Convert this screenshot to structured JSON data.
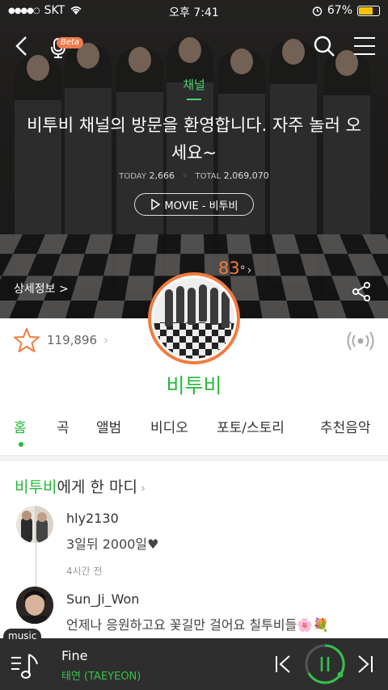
{
  "status_bar": {
    "carrier": "SKT",
    "time": "오후 7:41",
    "battery": "67%"
  },
  "header": {
    "beta_label": "Beta"
  },
  "channel": {
    "label": "채널",
    "title": "비투비 채널의 방문을 환영합니다. 자주 놀러 오세요~",
    "today_label": "TODAY",
    "today_value": "2,666",
    "total_label": "TOTAL",
    "total_value": "2,069,070",
    "movie_button": "MOVIE - 비투비",
    "degree": "83",
    "degree_unit": "°",
    "detail_link": "상세정보 >"
  },
  "artist": {
    "name": "비투비",
    "fan_count": "119,896"
  },
  "tabs": [
    "홈",
    "곡",
    "앨범",
    "비디오",
    "포토/스토리",
    "추천음악"
  ],
  "comments_section": {
    "title_highlight": "비투비",
    "title_rest": "에게 한 마디"
  },
  "comments": [
    {
      "user": "hly2130",
      "text": "3일뒤 2000일♥",
      "time": "4시간 전"
    },
    {
      "user": "Sun_Ji_Won",
      "text": "언제나 응원하고요 꽃길만 걸어요 칠투비들🌸💐"
    }
  ],
  "player": {
    "tag": "music",
    "song": "Fine",
    "artist": "태연 (TAEYEON)"
  },
  "colors": {
    "accent_green": "#28b83a",
    "degree_orange": "#f27b3f",
    "player_bg": "#2e2e2e"
  }
}
